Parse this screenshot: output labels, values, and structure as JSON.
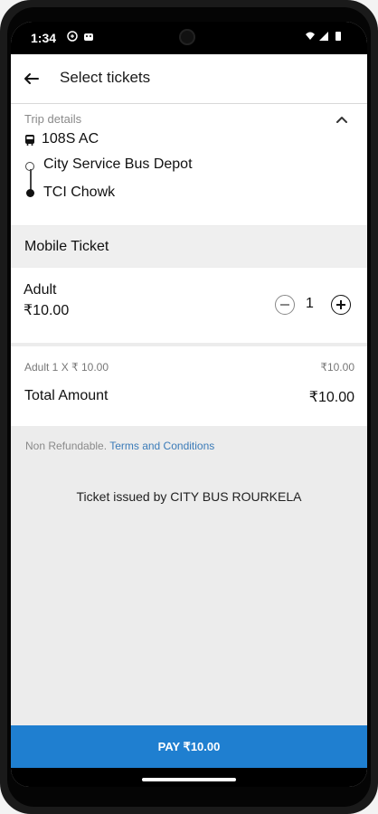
{
  "status": {
    "time": "1:34",
    "icons": [
      "vpn-icon",
      "android-icon",
      "wifi-icon",
      "signal-icon",
      "battery-icon"
    ]
  },
  "appbar": {
    "title": "Select tickets"
  },
  "trip_details": {
    "label": "Trip details",
    "route": "108S AC",
    "from": "City Service Bus Depot",
    "to": "TCI Chowk"
  },
  "ticket_type": {
    "label": "Mobile Ticket"
  },
  "fare": {
    "type": "Adult",
    "price": "₹10.00",
    "quantity": "1"
  },
  "summary": {
    "line_left": "Adult 1 X ₹ 10.00",
    "line_right": "₹10.00",
    "total_label": "Total Amount",
    "total_value": "₹10.00"
  },
  "terms": {
    "text": "Non Refundable.",
    "link": "Terms and Conditions"
  },
  "issuer": {
    "text": "Ticket issued by CITY BUS ROURKELA"
  },
  "cta": {
    "pay_label": "PAY ₹10.00"
  },
  "colors": {
    "primary": "#1f7fd0",
    "link": "#3b7bb8"
  }
}
